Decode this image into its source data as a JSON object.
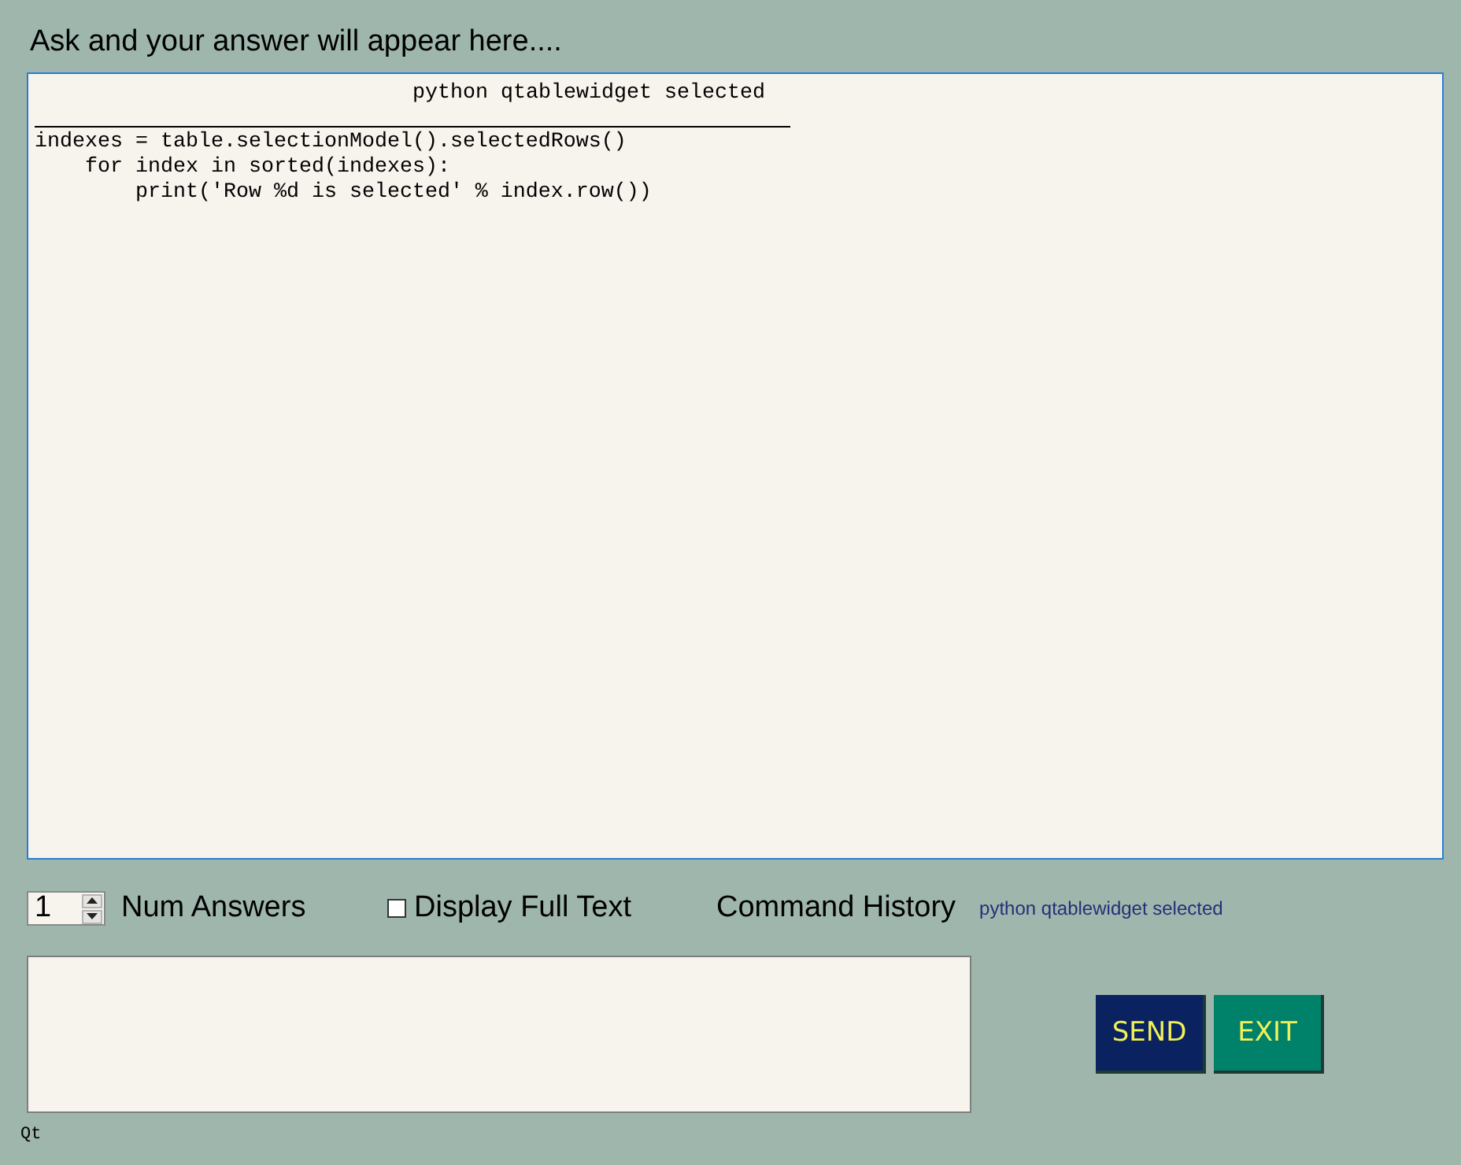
{
  "header": {
    "title": "Ask and your answer will appear here...."
  },
  "answer": {
    "focused": true,
    "heading": "python qtablewidget selected",
    "code_lines": [
      "indexes = table.selectionModel().selectedRows()",
      "    for index in sorted(indexes):",
      "        print('Row %d is selected' % index.row())"
    ]
  },
  "controls": {
    "num_answers": {
      "value": "1",
      "label": "Num Answers"
    },
    "full_text": {
      "label": "Display Full Text",
      "checked": false
    },
    "history": {
      "label": "Command History",
      "entry": "python qtablewidget selected"
    }
  },
  "buttons": [
    {
      "kind": "send",
      "label": "SEND"
    },
    {
      "kind": "exit",
      "label": "EXIT"
    }
  ],
  "status": "Qt"
}
